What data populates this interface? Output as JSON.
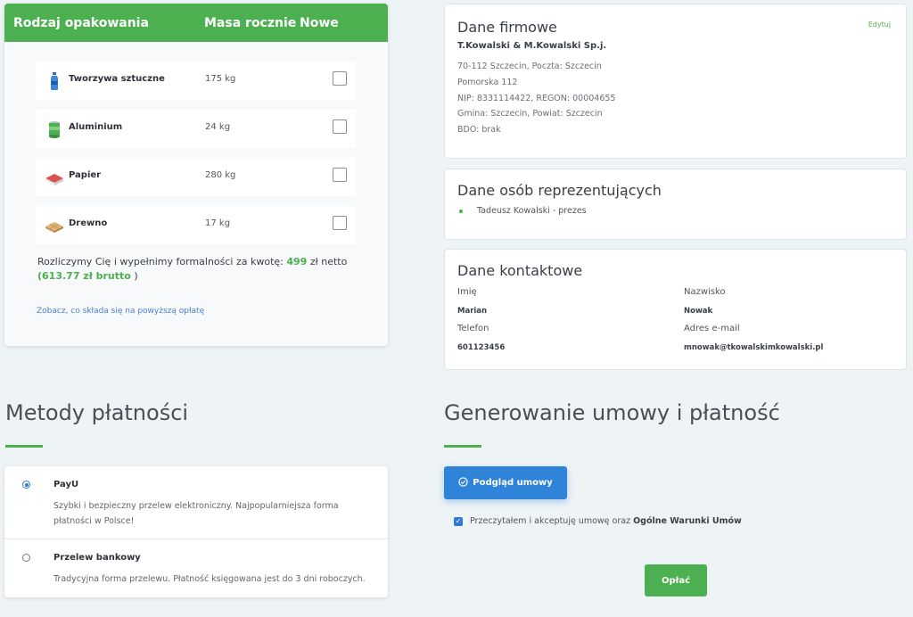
{
  "packaging": {
    "headers": {
      "type": "Rodzaj opakowania",
      "mass": "Masa rocznie",
      "new": "Nowe"
    },
    "rows": [
      {
        "name": "Tworzywa sztuczne",
        "mass": "175 kg",
        "icon": "plastic-bottle-icon",
        "checked": false
      },
      {
        "name": "Aluminium",
        "mass": "24 kg",
        "icon": "aluminium-can-icon",
        "checked": false
      },
      {
        "name": "Papier",
        "mass": "280 kg",
        "icon": "paper-box-icon",
        "checked": false
      },
      {
        "name": "Drewno",
        "mass": "17 kg",
        "icon": "wooden-pallet-icon",
        "checked": false
      }
    ],
    "price_prefix": "Rozliczymy Cię i wypełnimy formalności za kwotę: ",
    "price_net_value": "499",
    "price_net_suffix": " zł netto",
    "price_open": "(",
    "price_gross": "613.77 zł brutto",
    "price_close": " )",
    "fee_link": "Zobacz, co składa się na powyższą opłatę"
  },
  "company": {
    "title": "Dane firmowe",
    "edit_label": "Edytuj",
    "name": "T.Kowalski & M.Kowalski Sp.j.",
    "lines": [
      "70-112 Szczecin, Poczta: Szczecin",
      "Pomorska 112",
      "NIP: 8331114422, REGON: 00004655",
      "Gmina: Szczecin, Powiat: Szczecin",
      "BDO: brak"
    ]
  },
  "representatives": {
    "title": "Dane osób reprezentujących",
    "items": [
      "Tadeusz Kowalski - prezes"
    ]
  },
  "contact": {
    "title": "Dane kontaktowe",
    "first_name_label": "Imię",
    "first_name": "Marian",
    "last_name_label": "Nazwisko",
    "last_name": "Nowak",
    "phone_label": "Telefon",
    "phone": "601123456",
    "email_label": "Adres e-mail",
    "email": "mnowak@tkowalskimkowalski.pl"
  },
  "payment_methods": {
    "title": "Metody płatności",
    "options": [
      {
        "name": "PayU",
        "description": "Szybki i bezpieczny przelew elektroniczny. Najpopularniejsza forma płatności w Polsce!",
        "selected": true
      },
      {
        "name": "Przelew bankowy",
        "description": "Tradycyjna forma przelewu. Płatność księgowana jest do 3 dni roboczych.",
        "selected": false
      }
    ]
  },
  "contract": {
    "title": "Generowanie umowy i płatność",
    "preview_button": "Podgląd umowy",
    "accept_text": "Przeczytałem i akceptuję umowę oraz ",
    "accept_terms": "Ogólne Warunki Umów",
    "accept_checked": true,
    "pay_button": "Opłać"
  },
  "colors": {
    "accent_green": "#4caf50",
    "accent_blue": "#2f83d8",
    "background": "#eef3f6"
  }
}
